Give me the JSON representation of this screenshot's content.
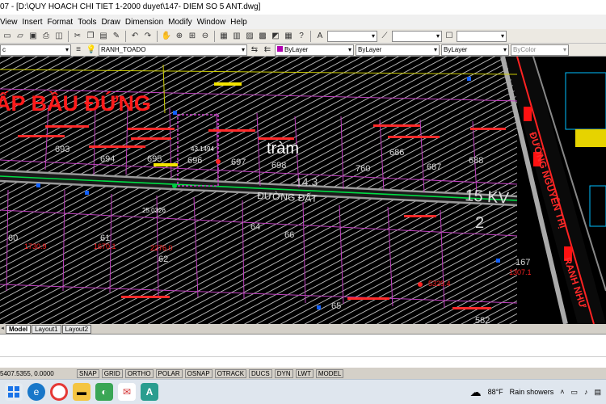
{
  "window": {
    "title": "07 - [D:\\QUY HOACH CHI TIET 1-2000 duyet\\147- DIEM SO 5 ANT.dwg]"
  },
  "menu": [
    "View",
    "Insert",
    "Format",
    "Tools",
    "Draw",
    "Dimension",
    "Modify",
    "Window",
    "Help"
  ],
  "toolbar": {
    "layer_combo": "RANH_TOADO",
    "color_combo": "ByLayer",
    "linetype_combo": "ByLayer",
    "lineweight_combo": "ByLayer",
    "plotstyle_combo": "ByColor",
    "left_combo": "c"
  },
  "drawing": {
    "labels": {
      "ap_bau_dung": "ẤP BẦU ĐỨNG",
      "tram": "tràm",
      "duong_dat": "ĐƯỜNG ĐẤT",
      "duong_nguyen_thi": "ĐƯỜNG NGUYỄN THỊ",
      "ranh_nhu": "RANH NHƯ",
      "dim_43": "43.1494",
      "dim_25": "25.0326",
      "num_143": "14.3",
      "num_15k": "15 KV",
      "num_2": "2",
      "lot_60": "60",
      "lot_61": "61",
      "lot_62": "62",
      "lot_64": "64",
      "lot_65": "65",
      "lot_66": "66",
      "lot_693": "693",
      "lot_694": "694",
      "lot_695": "695",
      "lot_696": "696",
      "lot_697": "697",
      "lot_698": "698",
      "lot_760": "760",
      "lot_686": "686",
      "lot_688": "688",
      "lot_687": "687",
      "lot_582": "582",
      "lot_167": "167",
      "area_1": "1730.9",
      "area_2": "1670.1",
      "area_3": "2276.0",
      "area_4": "5329.4",
      "area_5": "1307.1",
      "road_kv": "15 KV"
    }
  },
  "tabs": {
    "model": "Model",
    "layout1": "Layout1",
    "layout2": "Layout2"
  },
  "status": {
    "coords": "5407.5355, 0.0000",
    "buttons": [
      "SNAP",
      "GRID",
      "ORTHO",
      "POLAR",
      "OSNAP",
      "OTRACK",
      "DUCS",
      "DYN",
      "LWT",
      "MODEL"
    ]
  },
  "taskbar": {
    "weather": "88°F",
    "weather_text": "Rain showers"
  }
}
